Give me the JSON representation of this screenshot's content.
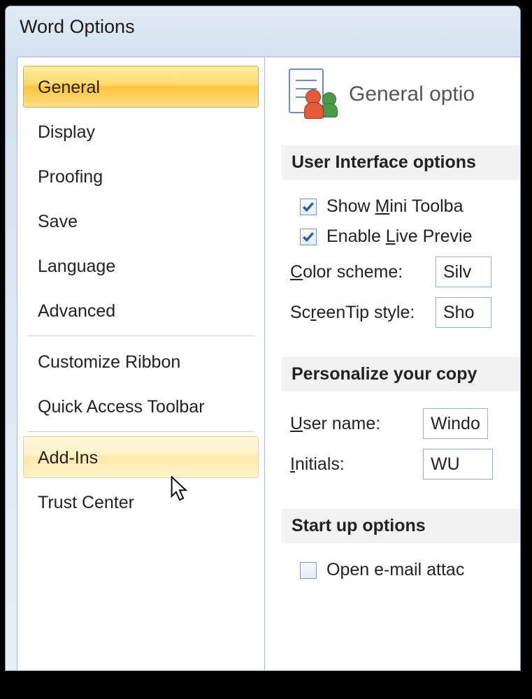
{
  "window": {
    "title": "Word Options"
  },
  "sidebar": {
    "groups": [
      [
        "General",
        "Display",
        "Proofing",
        "Save",
        "Language",
        "Advanced"
      ],
      [
        "Customize Ribbon",
        "Quick Access Toolbar"
      ],
      [
        "Add-Ins",
        "Trust Center"
      ]
    ],
    "selected": "General",
    "hovered": "Add-Ins"
  },
  "main": {
    "header_title": "General optio",
    "sections": {
      "ui": {
        "title": "User Interface options",
        "mini_toolbar": {
          "checked": true,
          "label_pre": "Show ",
          "label_u": "M",
          "label_post": "ini Toolba"
        },
        "live_preview": {
          "checked": true,
          "label_pre": "Enable ",
          "label_u": "L",
          "label_post": "ive Previe"
        },
        "color_scheme": {
          "label_u": "C",
          "label_post": "olor scheme:",
          "value": "Silv"
        },
        "screentip": {
          "label_pre": "Sc",
          "label_u": "r",
          "label_post": "eenTip style:",
          "value": "Sho"
        }
      },
      "personalize": {
        "title": "Personalize your copy",
        "user_name": {
          "label_u": "U",
          "label_post": "ser name:",
          "value": "Windo"
        },
        "initials": {
          "label_u": "I",
          "label_post": "nitials:",
          "value": "WU"
        }
      },
      "startup": {
        "title": "Start up options",
        "open_email": {
          "checked": false,
          "label": "Open e-mail attac"
        }
      }
    }
  }
}
